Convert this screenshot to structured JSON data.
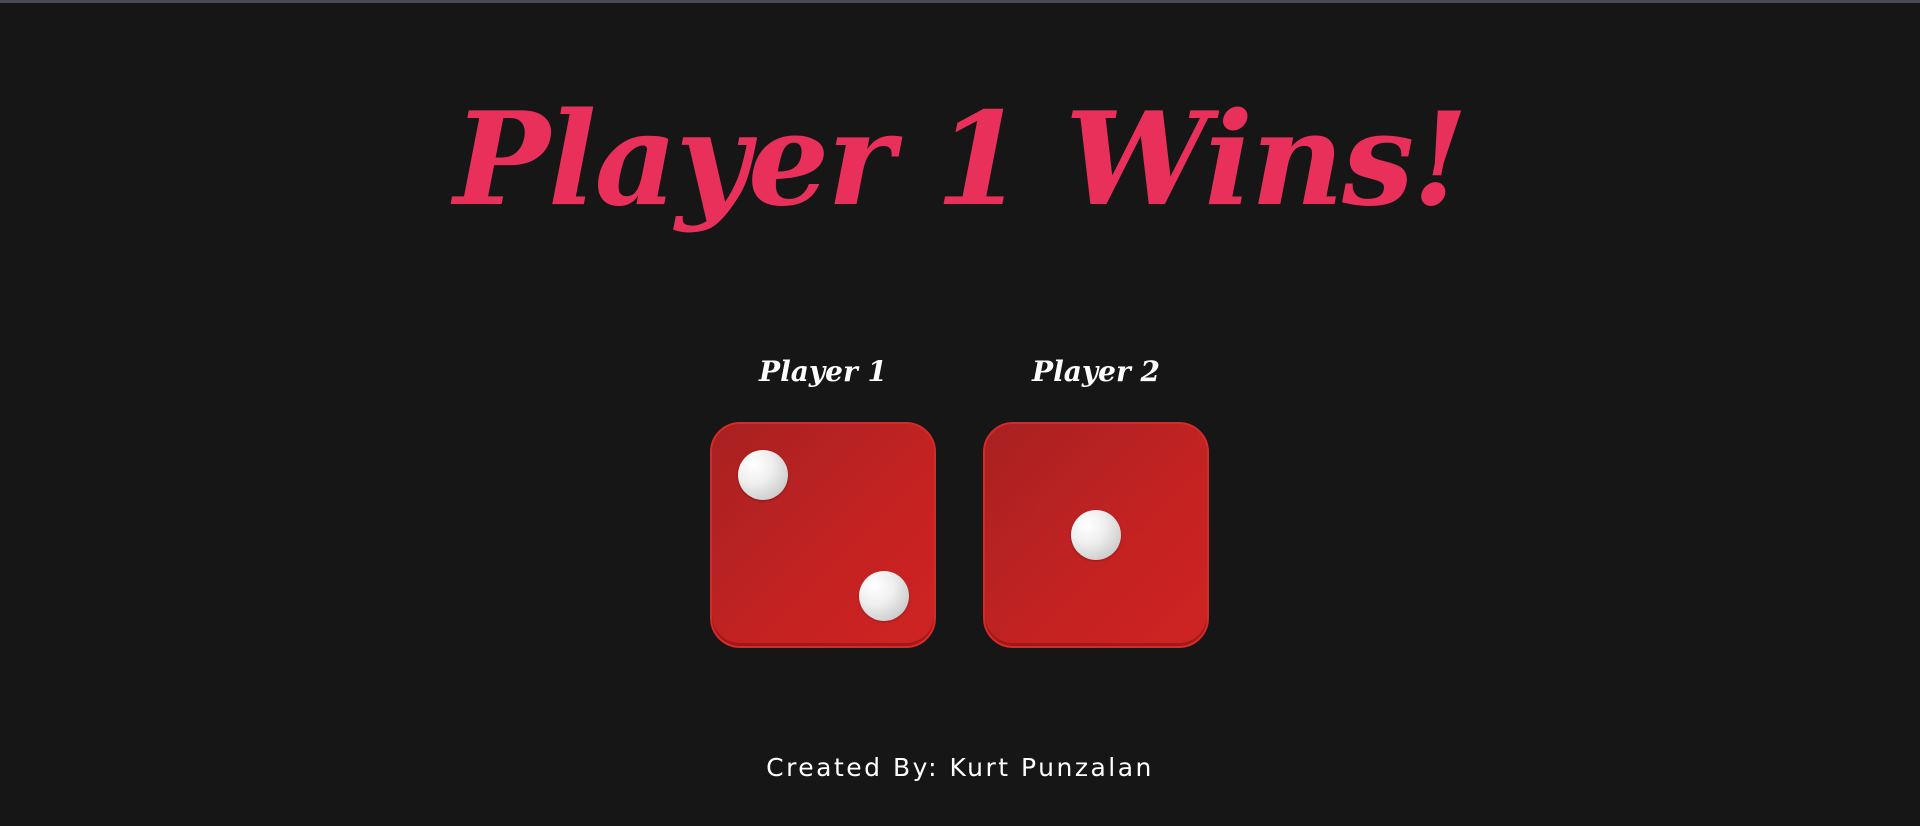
{
  "title": "Player 1 Wins!",
  "players": [
    {
      "label": "Player 1",
      "die_value": 2
    },
    {
      "label": "Player 2",
      "die_value": 1
    }
  ],
  "footer": "Created By: Kurt Punzalan",
  "colors": {
    "background": "#161617",
    "title": "#e8305a",
    "die": "#c52222",
    "pip": "#ffffff",
    "text": "#ffffff"
  }
}
